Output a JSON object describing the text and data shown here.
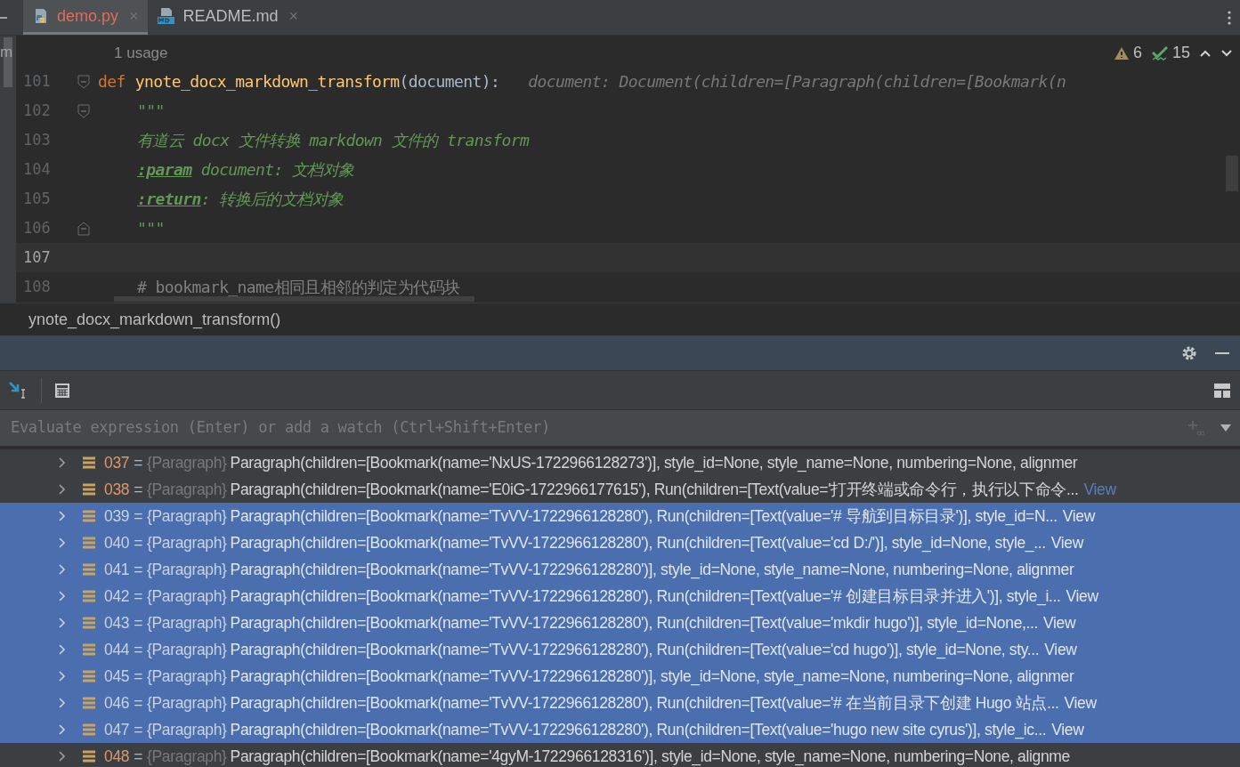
{
  "tabs": [
    {
      "label": "demo.py",
      "kind": "python",
      "selected": true,
      "close": "×"
    },
    {
      "label": "README.md",
      "kind": "markdown",
      "selected": false,
      "close": "×"
    }
  ],
  "side_strip_text": "m",
  "editor": {
    "usages": "1 usage",
    "warnings": "6",
    "checks": "15",
    "lines": [
      {
        "number": "101",
        "current": false,
        "fold_start": true,
        "indented": false,
        "tokens": [
          {
            "kind": "keyword",
            "text": "def"
          },
          {
            "kind": "function",
            "text": "ynote_docx_markdown_transform"
          },
          {
            "kind": "plain",
            "text": "(document):"
          },
          {
            "kind": "hint",
            "text": "document: Document(children=[Paragraph(children=[Bookmark(n"
          }
        ]
      },
      {
        "number": "102",
        "current": false,
        "fold_start": true,
        "indented": true,
        "tokens": [
          {
            "kind": "docstring",
            "text": "\"\"\""
          }
        ]
      },
      {
        "number": "103",
        "current": false,
        "indented": true,
        "tokens": [
          {
            "kind": "docstring",
            "text": "有道云 docx 文件转换 markdown 文件的 transform"
          }
        ]
      },
      {
        "number": "104",
        "current": false,
        "indented": true,
        "tokens": [
          {
            "kind": "doctag",
            "text": ":param"
          },
          {
            "kind": "docstring",
            "text": " document: 文档对象"
          }
        ]
      },
      {
        "number": "105",
        "current": false,
        "indented": true,
        "tokens": [
          {
            "kind": "doctag",
            "text": ":return"
          },
          {
            "kind": "docstring",
            "text": ": 转换后的文档对象"
          }
        ]
      },
      {
        "number": "106",
        "current": false,
        "fold_end": true,
        "indented": true,
        "tokens": [
          {
            "kind": "docstring",
            "text": "\"\"\""
          }
        ]
      },
      {
        "number": "107",
        "current": true
      },
      {
        "number": "108",
        "current": false,
        "indented": true,
        "tokens": [
          {
            "kind": "comment",
            "text": "# bookmark_name相同且相邻的判定为代码块"
          }
        ]
      }
    ]
  },
  "breadcrumb": "ynote_docx_markdown_transform()",
  "evaluate": {
    "placeholder": "Evaluate expression (Enter) or add a watch (Ctrl+Shift+Enter)"
  },
  "variables": [
    {
      "index": "037",
      "eq": "=",
      "type": "{Paragraph}",
      "value": "Paragraph(children=[Bookmark(name='NxUS-1722966128273')], style_id=None, style_name=None, numbering=None, alignmer",
      "selected": false
    },
    {
      "index": "038",
      "eq": "=",
      "type": "{Paragraph}",
      "value": "Paragraph(children=[Bookmark(name='E0iG-1722966177615'), Run(children=[Text(value='打开终端或命令行，执行以下命令...",
      "link": "View",
      "selected": false
    },
    {
      "index": "039",
      "eq": "=",
      "type": "{Paragraph}",
      "value": "Paragraph(children=[Bookmark(name='TvVV-1722966128280'), Run(children=[Text(value='# 导航到目标目录')], style_id=N...",
      "link": "View",
      "selected": true
    },
    {
      "index": "040",
      "eq": "=",
      "type": "{Paragraph}",
      "value": "Paragraph(children=[Bookmark(name='TvVV-1722966128280'), Run(children=[Text(value='cd D:/')], style_id=None, style_...",
      "link": "View",
      "selected": true
    },
    {
      "index": "041",
      "eq": "=",
      "type": "{Paragraph}",
      "value": "Paragraph(children=[Bookmark(name='TvVV-1722966128280')], style_id=None, style_name=None, numbering=None, alignmer",
      "selected": true
    },
    {
      "index": "042",
      "eq": "=",
      "type": "{Paragraph}",
      "value": "Paragraph(children=[Bookmark(name='TvVV-1722966128280'), Run(children=[Text(value='# 创建目标目录并进入')], style_i...",
      "link": "View",
      "selected": true
    },
    {
      "index": "043",
      "eq": "=",
      "type": "{Paragraph}",
      "value": "Paragraph(children=[Bookmark(name='TvVV-1722966128280'), Run(children=[Text(value='mkdir hugo')], style_id=None,...",
      "link": "View",
      "selected": true
    },
    {
      "index": "044",
      "eq": "=",
      "type": "{Paragraph}",
      "value": "Paragraph(children=[Bookmark(name='TvVV-1722966128280'), Run(children=[Text(value='cd hugo')], style_id=None, sty...",
      "link": "View",
      "selected": true
    },
    {
      "index": "045",
      "eq": "=",
      "type": "{Paragraph}",
      "value": "Paragraph(children=[Bookmark(name='TvVV-1722966128280')], style_id=None, style_name=None, numbering=None, alignmer",
      "selected": true
    },
    {
      "index": "046",
      "eq": "=",
      "type": "{Paragraph}",
      "value": "Paragraph(children=[Bookmark(name='TvVV-1722966128280'), Run(children=[Text(value='# 在当前目录下创建 Hugo 站点...",
      "link": "View",
      "selected": true
    },
    {
      "index": "047",
      "eq": "=",
      "type": "{Paragraph}",
      "value": "Paragraph(children=[Bookmark(name='TvVV-1722966128280'), Run(children=[Text(value='hugo new site cyrus')], style_ic...",
      "link": "View",
      "selected": true
    },
    {
      "index": "048",
      "eq": "=",
      "type": "{Paragraph}",
      "value": "Paragraph(children=[Bookmark(name='4gyM-1722966128316')], style_id=None, style_name=None, numbering=None, alignme",
      "selected": false
    }
  ]
}
